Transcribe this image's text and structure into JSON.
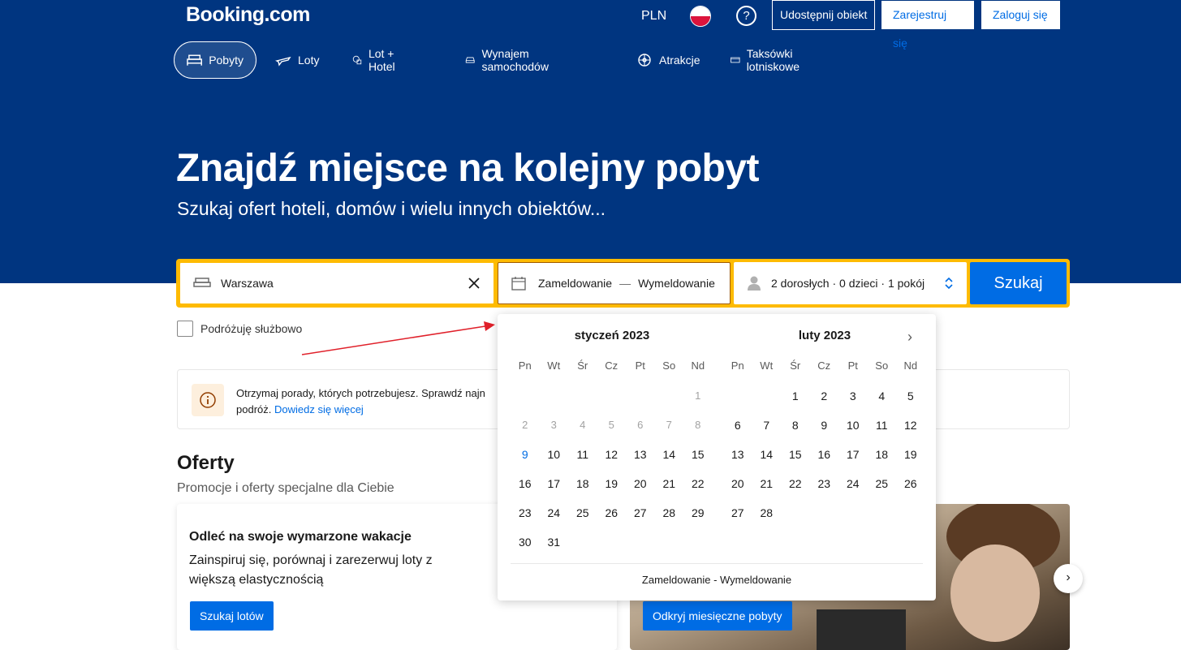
{
  "header": {
    "logo": "Booking.com",
    "currency": "PLN",
    "list_property": "Udostępnij obiekt",
    "register": "Zarejestruj się",
    "login": "Zaloguj się",
    "help_glyph": "?"
  },
  "nav": [
    {
      "label": "Pobyty",
      "icon": "bed-icon",
      "active": true
    },
    {
      "label": "Loty",
      "icon": "plane-icon"
    },
    {
      "label": "Lot + Hotel",
      "icon": "plane-hotel-icon"
    },
    {
      "label": "Wynajem samochodów",
      "icon": "car-icon"
    },
    {
      "label": "Atrakcje",
      "icon": "attractions-icon"
    },
    {
      "label": "Taksówki lotniskowe",
      "icon": "taxi-icon"
    }
  ],
  "hero": {
    "title": "Znajdź miejsce na kolejny pobyt",
    "subtitle": "Szukaj ofert hoteli, domów i wielu innych obiektów..."
  },
  "search": {
    "destination": "Warszawa",
    "checkin": "Zameldowanie",
    "dash": "—",
    "checkout": "Wymeldowanie",
    "guests": "2 dorosłych · 0 dzieci · 1 pokój",
    "button": "Szukaj"
  },
  "business_travel": "Podróżuję służbowo",
  "info": {
    "text": "Otrzymaj porady, których potrzebujesz. Sprawdź najn",
    "text2": "podróż.",
    "link": "Dowiedz się więcej"
  },
  "offers": {
    "title": "Oferty",
    "subtitle": "Promocje i oferty specjalne dla Ciebie",
    "card1_title": "Odleć na swoje wymarzone wakacje",
    "card1_desc": "Zainspiruj się, porównaj i zarezerwuj loty z większą elastycznością",
    "card1_button": "Szukaj lotów",
    "card2_button": "Odkryj miesięczne pobyty"
  },
  "calendar": {
    "weekdays": [
      "Pn",
      "Wt",
      "Śr",
      "Cz",
      "Pt",
      "So",
      "Nd"
    ],
    "months": [
      {
        "title": "styczeń 2023",
        "cells": [
          "",
          "",
          "",
          "",
          "",
          "",
          "1",
          "2",
          "3",
          "4",
          "5",
          "6",
          "7",
          "8",
          "9",
          "10",
          "11",
          "12",
          "13",
          "14",
          "15",
          "16",
          "17",
          "18",
          "19",
          "20",
          "21",
          "22",
          "23",
          "24",
          "25",
          "26",
          "27",
          "28",
          "29",
          "30",
          "31"
        ],
        "disabled_until": 8,
        "today": 9
      },
      {
        "title": "luty 2023",
        "cells": [
          "",
          "",
          "1",
          "2",
          "3",
          "4",
          "5",
          "6",
          "7",
          "8",
          "9",
          "10",
          "11",
          "12",
          "13",
          "14",
          "15",
          "16",
          "17",
          "18",
          "19",
          "20",
          "21",
          "22",
          "23",
          "24",
          "25",
          "26",
          "27",
          "28"
        ],
        "disabled_until": 0,
        "today": 0
      }
    ],
    "footer": "Zameldowanie - Wymeldowanie",
    "next_glyph": "›"
  },
  "carousel_next_glyph": "›",
  "colors": {
    "brand": "#003580",
    "accent": "#006ce4",
    "searchbar": "#febb02"
  }
}
